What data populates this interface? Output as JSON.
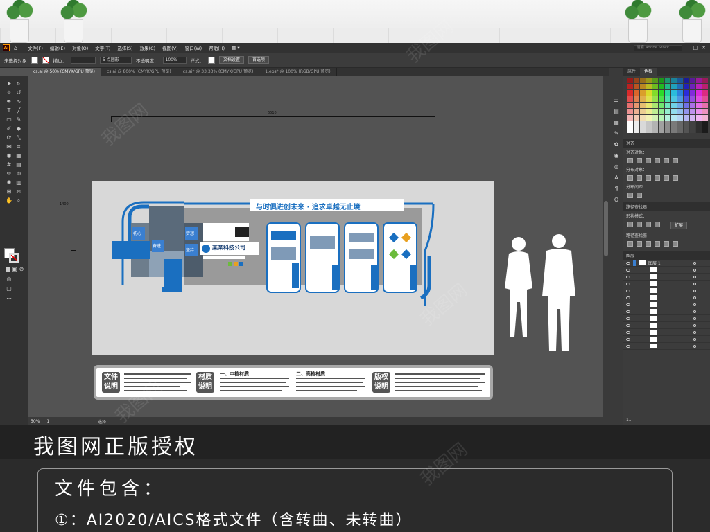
{
  "menubar": {
    "logo": "Ai",
    "items": [
      "文件(F)",
      "编辑(E)",
      "对象(O)",
      "文字(T)",
      "选择(S)",
      "效果(C)",
      "视图(V)",
      "窗口(W)",
      "帮助(H)"
    ],
    "search_placeholder": "搜索 Adobe Stock"
  },
  "control_bar": {
    "selection": "未选择对象",
    "stroke_label": "描边：",
    "brush": "5 点圆形",
    "opacity_label": "不透明度：",
    "opacity_value": "100%",
    "style_label": "样式：",
    "doc_setup": "文档设置",
    "prefs": "首选项"
  },
  "tabs": [
    {
      "label": "cs.ai @ 50% (CMYK/GPU 预览)",
      "active": true
    },
    {
      "label": "cs.ai @ 800% (CMYK/GPU 预览)",
      "active": false
    },
    {
      "label": "cs.ai* @ 33.33% (CMYK/GPU 预览)",
      "active": false
    },
    {
      "label": "1.eps* @ 100% (RGB/GPU 预览)",
      "active": false
    }
  ],
  "artboard": {
    "width_dim": "6510",
    "height_dim": "1400",
    "slogan": "与时俱进创未来 · 追求卓越无止境",
    "company": "某某科技公司",
    "pillar_labels": [
      "初心",
      "奋进",
      "梦想",
      "坚持"
    ]
  },
  "legend": {
    "box1": "文件说明",
    "box2": "材质说明",
    "head1": "一、中档材质",
    "head2": "二、高档材质",
    "box3": "版权说明"
  },
  "status_bar": {
    "zoom": "50%",
    "artboard_index": "1",
    "tool": "选择"
  },
  "panel": {
    "tabs": [
      "属性",
      "色板"
    ],
    "align_title": "对齐",
    "align_objects": "对齐对象：",
    "distribute_objects": "分布对象：",
    "distribute_spacing": "分布间距：",
    "pathfinder_title": "路径查找器",
    "shape_modes": "形状模式：",
    "pathfinders": "路径查找器：",
    "expand_btn": "扩展",
    "layers_title": "图层",
    "layer_name": "图层 1",
    "layers_count": "1..."
  },
  "banner": {
    "title": "我图网正版授权",
    "files_label": "文件包含：",
    "files_detail": "①：AI2020/AICS格式文件（含转曲、未转曲）"
  },
  "watermark": "我图网",
  "colors": {
    "accent_blue": "#1a6fc0",
    "ai_orange": "#ff9a00"
  }
}
